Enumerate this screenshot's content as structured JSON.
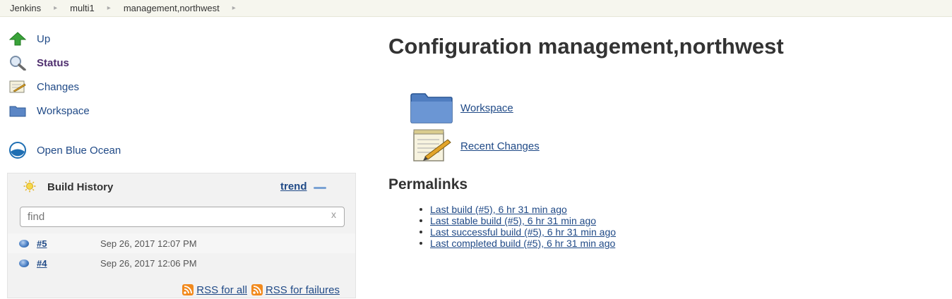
{
  "breadcrumbs": [
    {
      "label": "Jenkins"
    },
    {
      "label": "multi1"
    },
    {
      "label": "management,northwest"
    }
  ],
  "breadcrumb_separator": "▸",
  "sidebar": {
    "tasks": [
      {
        "label": "Up",
        "icon": "up-arrow-icon"
      },
      {
        "label": "Status",
        "icon": "search-magnifier-icon"
      },
      {
        "label": "Changes",
        "icon": "notepad-icon"
      },
      {
        "label": "Workspace",
        "icon": "folder-icon"
      },
      {
        "label": "Open Blue Ocean",
        "icon": "blue-ocean-icon"
      }
    ]
  },
  "build_history": {
    "title": "Build History",
    "trend_label": "trend",
    "search_placeholder": "find",
    "clear_label": "x",
    "builds": [
      {
        "number": "#5",
        "date": "Sep 26, 2017 12:07 PM",
        "status": "blue"
      },
      {
        "number": "#4",
        "date": "Sep 26, 2017 12:06 PM",
        "status": "blue"
      }
    ],
    "rss_all": "RSS for all",
    "rss_failures": "RSS for failures"
  },
  "main": {
    "title": "Configuration management,northwest",
    "links": [
      {
        "label": "Workspace",
        "icon": "folder-icon"
      },
      {
        "label": "Recent Changes",
        "icon": "notepad-icon"
      }
    ],
    "permalinks_title": "Permalinks",
    "permalinks": [
      "Last build (#5), 6 hr 31 min ago",
      "Last stable build (#5), 6 hr 31 min ago",
      "Last successful build (#5), 6 hr 31 min ago",
      "Last completed build (#5), 6 hr 31 min ago"
    ]
  },
  "colors": {
    "link": "#204a87",
    "breadcrumb_bg": "#f6f6ee",
    "rss": "#f28a1d"
  }
}
